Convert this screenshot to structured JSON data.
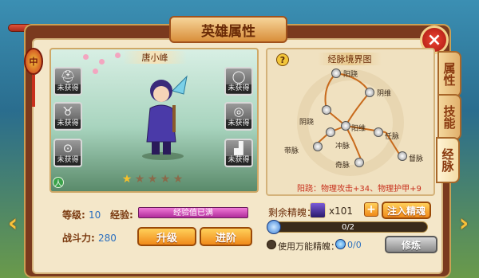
{
  "window": {
    "title": "英雄属性",
    "close_icon": "×"
  },
  "side_tabs": [
    {
      "label": "属性",
      "active": false
    },
    {
      "label": "技能",
      "active": false
    },
    {
      "label": "经脉",
      "active": true
    }
  ],
  "charm": {
    "glyph": "中"
  },
  "hero": {
    "name": "唐小峰",
    "stars": 5,
    "stars_filled": 1,
    "equipment_slots": [
      {
        "icon": "helmet-icon",
        "glyph": "⛑",
        "status": "未获得"
      },
      {
        "icon": "ring-icon",
        "glyph": "◯",
        "status": "未获得"
      },
      {
        "icon": "amulet-icon",
        "glyph": "♉",
        "status": "未获得"
      },
      {
        "icon": "bracelet-icon",
        "glyph": "◎",
        "status": "未获得"
      },
      {
        "icon": "necklace-icon",
        "glyph": "⊙",
        "status": "未获得"
      },
      {
        "icon": "boots-icon",
        "glyph": "▟",
        "status": "未获得"
      }
    ],
    "badge_glyph": "人"
  },
  "stats": {
    "level_label": "等级:",
    "level_value": "10",
    "exp_label": "经验:",
    "exp_text": "经验值已满",
    "power_label": "战斗力:",
    "power_value": "280"
  },
  "buttons": {
    "upgrade": "升级",
    "advance": "进阶",
    "inject": "注入精魂",
    "practice": "修炼",
    "plus": "+",
    "help": "?"
  },
  "meridian": {
    "title": "经脉境界图",
    "nodes": [
      "阳跷",
      "阴维",
      "阴跷",
      "阳维",
      "冲脉",
      "任脉",
      "带脉",
      "督脉",
      "奇脉"
    ],
    "effect": "阳跷：物理攻击+34、物理护甲+9"
  },
  "soul": {
    "label": "剩余精魄：",
    "count": "x101",
    "progress_text": "0/2",
    "progress": 0,
    "use_label": "使用万能精魄：",
    "ratio": "0/0"
  },
  "colors": {
    "accent": "#f08a1a",
    "exp_bar": "#d04ab8",
    "effect": "#c8301c"
  }
}
